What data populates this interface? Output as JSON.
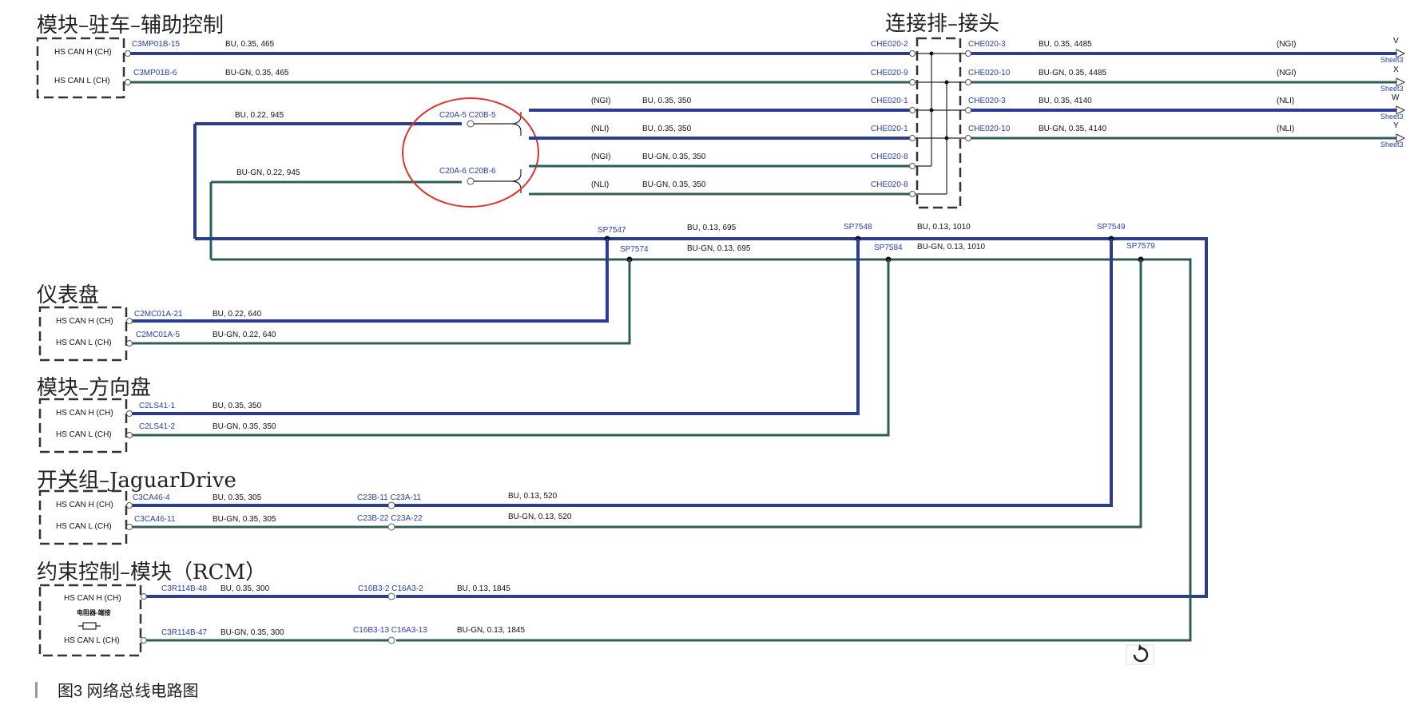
{
  "modules": {
    "parking": {
      "title": "模块–驻车–辅助控制",
      "h": "HS CAN H (CH)",
      "l": "HS CAN L (CH)",
      "h_conn": "C3MP01B-15",
      "h_wire": "BU, 0.35, 465",
      "l_conn": "C3MP01B-6",
      "l_wire": "BU-GN, 0.35, 465"
    },
    "cluster": {
      "title": "仪表盘",
      "h": "HS CAN H (CH)",
      "l": "HS CAN L (CH)",
      "h_conn": "C2MC01A-21",
      "h_wire": "BU, 0.22, 640",
      "l_conn": "C2MC01A-5",
      "l_wire": "BU-GN, 0.22, 640"
    },
    "steering": {
      "title": "模块–方向盘",
      "h": "HS CAN H (CH)",
      "l": "HS CAN L (CH)",
      "h_conn": "C2LS41-1",
      "h_wire": "BU, 0.35, 350",
      "l_conn": "C2LS41-2",
      "l_wire": "BU-GN, 0.35, 350"
    },
    "jaguar": {
      "title": "开关组–JaguarDrive",
      "h": "HS CAN H (CH)",
      "l": "HS CAN L (CH)",
      "h_conn": "C3CA46-4",
      "h_wire": "BU, 0.35, 305",
      "l_conn": "C3CA46-11",
      "l_wire": "BU-GN, 0.35, 305",
      "h_mid": "C23B-11  C23A-11",
      "h_wire2": "BU, 0.13, 520",
      "l_mid": "C23B-22  C23A-22",
      "l_wire2": "BU-GN, 0.13, 520"
    },
    "rcm": {
      "title": "约束控制–模块（RCM）",
      "h": "HS CAN H (CH)",
      "l": "HS CAN L (CH)",
      "resistor": "电阻器-端接",
      "h_conn": "C3R114B-48",
      "h_wire": "BU, 0.35, 300",
      "l_conn": "C3R114B-47",
      "l_wire": "BU-GN, 0.35, 300",
      "h_mid": "C16B3-2  C16A3-2",
      "h_wire2": "BU, 0.13, 1845",
      "l_mid": "C16B3-13  C16A3-13",
      "l_wire2": "BU-GN, 0.13, 1845"
    }
  },
  "junction": {
    "title": "连接排–接头",
    "rows": [
      {
        "left": "CHE020-2",
        "right": "CHE020-3",
        "wire": "BU, 0.35, 4485",
        "tag": "(NGI)",
        "letter": "V",
        "sheet": "Sheet3"
      },
      {
        "left": "CHE020-9",
        "right": "CHE020-10",
        "wire": "BU-GN, 0.35, 4485",
        "tag": "(NGI)",
        "letter": "X",
        "sheet": "Sheet3"
      },
      {
        "left": "CHE020-1",
        "right": "CHE020-3",
        "wire": "BU, 0.35, 4140",
        "tag": "(NLI)",
        "letter": "W",
        "sheet": "Sheet3"
      },
      {
        "left": "CHE020-1",
        "right": "CHE020-10",
        "wire": "BU-GN, 0.35, 4140",
        "tag": "(NLI)",
        "letter": "Y",
        "sheet": "Sheet3"
      },
      {
        "left": "CHE020-8"
      },
      {
        "left": "CHE020-8"
      }
    ]
  },
  "splice": {
    "h_conn": "C20A-5  C20B-5",
    "l_conn": "C20A-6  C20B-6",
    "h_in": "BU, 0.22, 945",
    "l_in": "BU-GN, 0.22, 945",
    "branches": [
      {
        "tag": "(NGI)",
        "wire": "BU, 0.35, 350"
      },
      {
        "tag": "(NLI)",
        "wire": "BU, 0.35, 350"
      },
      {
        "tag": "(NGI)",
        "wire": "BU-GN, 0.35, 350"
      },
      {
        "tag": "(NLI)",
        "wire": "BU-GN, 0.35, 350"
      }
    ]
  },
  "bus": {
    "sp7547": "SP7547",
    "sp7548": "SP7548",
    "sp7549": "SP7549",
    "sp7574": "SP7574",
    "sp7584": "SP7584",
    "sp7579": "SP7579",
    "h_w1": "BU, 0.13, 695",
    "h_w2": "BU, 0.13, 1010",
    "l_w1": "BU-GN, 0.13, 695",
    "l_w2": "BU-GN, 0.13, 1010"
  },
  "caption": "图3   网络总线电路图",
  "colors": {
    "bu": "#2b3d8f",
    "bugn": "#2f5d5a",
    "highlight": "#e0332b"
  }
}
